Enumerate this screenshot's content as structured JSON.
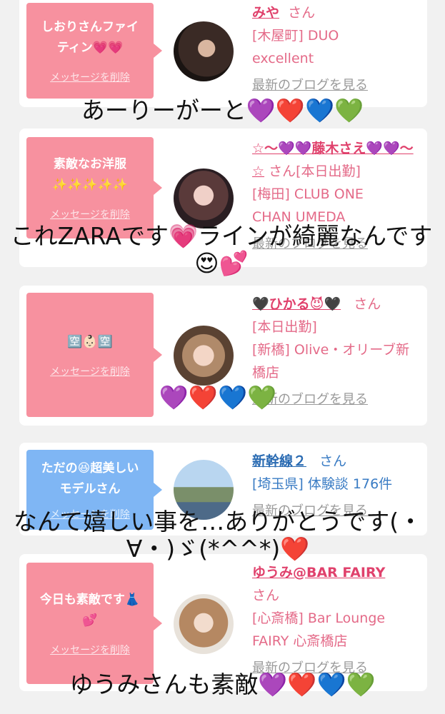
{
  "cards": [
    {
      "message": "しおりさんファイティン💗💗",
      "delete_label": "メッセージを削除",
      "name": "みや",
      "honorific": "さん",
      "area": "[木屋町] DUO excellent",
      "blog_link": "最新のブログを見る"
    },
    {
      "message": "素敵なお洋服✨✨✨✨✨",
      "delete_label": "メッセージを削除",
      "name": "☆〜💜💜藤木さえ💜💜〜☆",
      "honorific": "さん[本日出勤]",
      "area": "[梅田] CLUB ONE CHAN UMEDA",
      "blog_link": "最新のブログを見る"
    },
    {
      "message": "🈳👶🏻🈳",
      "delete_label": "メッセージを削除",
      "name": "🖤ひかる😈🖤",
      "honorific": "さん",
      "status": "[本日出勤]",
      "area": "[新橋] Olive・オリーブ新橋店",
      "blog_link": "最新のブログを見る"
    },
    {
      "message": "ただの😆超美しいモデルさん",
      "delete_label": "メッセージを削除",
      "name": "新幹線２",
      "honorific": "さん",
      "area": "[埼玉県] 体験談 176件",
      "blog_link": "最新のブログを見る"
    },
    {
      "message": "今日も素敵です👗💕",
      "delete_label": "メッセージを削除",
      "name": "ゆうみ@BAR FAIRY",
      "honorific": "さん",
      "area": "[心斎橋] Bar Lounge FAIRY 心斎橋店",
      "blog_link": "最新のブログを見る"
    }
  ],
  "captions": [
    "あーりーがーと💜❤️💙💚",
    "これZARAです💗ラインが綺麗なんです😍💕",
    "💜❤️💙💚",
    "なんて嬉しい事を…ありがとうです(・∀・)ゞ(*^^*)❤️",
    "ゆうみさんも素敵💜❤️💙💚"
  ],
  "colors": {
    "bubble_pink": "#f7919f",
    "bubble_blue": "#7fb6f4",
    "name_pink": "#e0416c",
    "name_blue": "#2a6bb2"
  }
}
